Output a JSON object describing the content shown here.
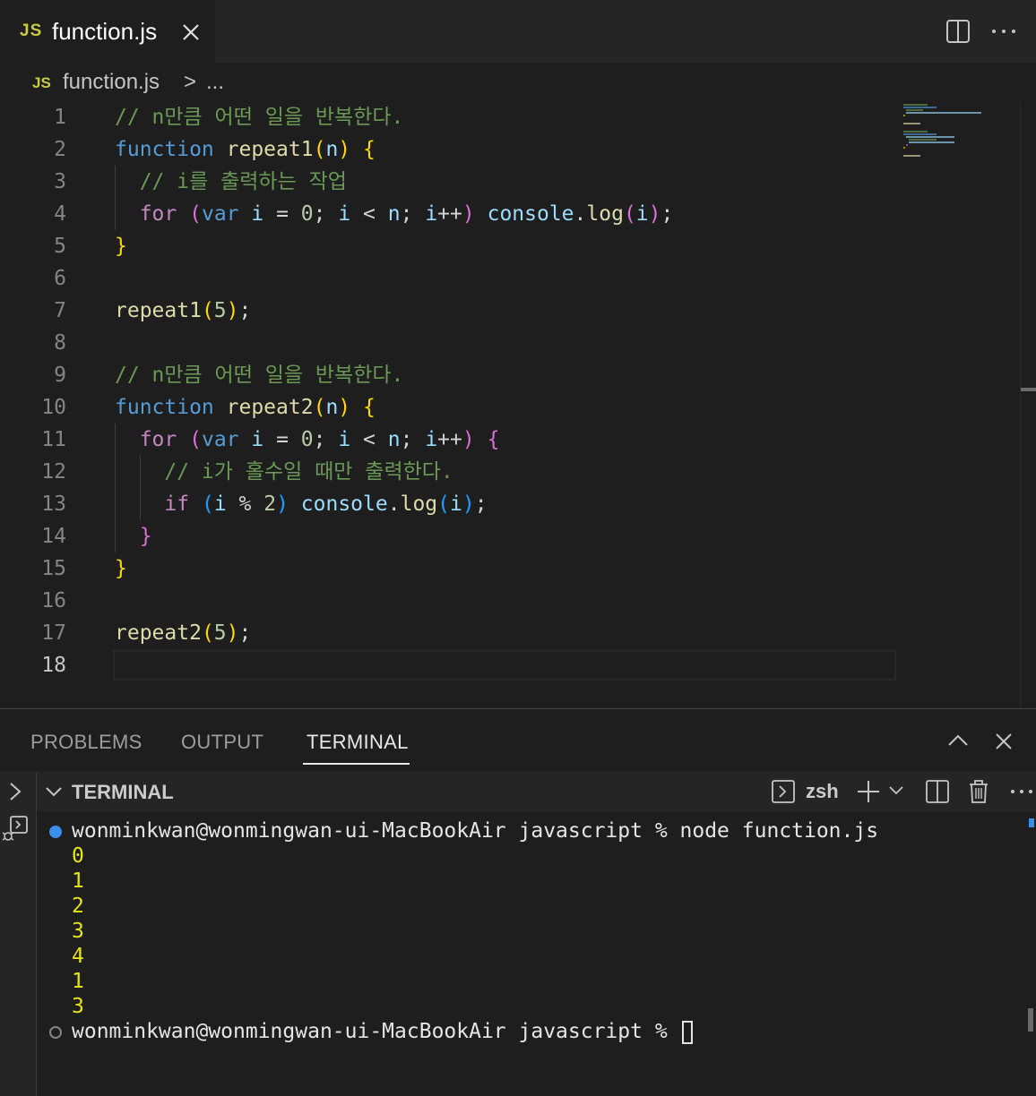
{
  "tab": {
    "icon_text": "JS",
    "filename": "function.js"
  },
  "breadcrumb": {
    "icon_text": "JS",
    "file": "function.js",
    "separator": ">",
    "more": "..."
  },
  "editor": {
    "active_line": 18,
    "lines": [
      {
        "n": "1",
        "t": [
          [
            "cm",
            "// n만큼 어떤 일을 반복한다."
          ]
        ]
      },
      {
        "n": "2",
        "t": [
          [
            "kw",
            "function"
          ],
          [
            "pn",
            " "
          ],
          [
            "fn",
            "repeat1"
          ],
          [
            "b1",
            "("
          ],
          [
            "pr",
            "n"
          ],
          [
            "b1",
            ")"
          ],
          [
            "pn",
            " "
          ],
          [
            "b1",
            "{"
          ]
        ]
      },
      {
        "n": "3",
        "t": [
          [
            "pn",
            "  "
          ],
          [
            "cm",
            "// i를 출력하는 작업"
          ]
        ]
      },
      {
        "n": "4",
        "t": [
          [
            "pn",
            "  "
          ],
          [
            "ct",
            "for"
          ],
          [
            "pn",
            " "
          ],
          [
            "b2",
            "("
          ],
          [
            "kw",
            "var"
          ],
          [
            "pn",
            " "
          ],
          [
            "pr",
            "i"
          ],
          [
            "pn",
            " = "
          ],
          [
            "nu",
            "0"
          ],
          [
            "pn",
            "; "
          ],
          [
            "pr",
            "i"
          ],
          [
            "pn",
            " < "
          ],
          [
            "pr",
            "n"
          ],
          [
            "pn",
            "; "
          ],
          [
            "pr",
            "i"
          ],
          [
            "pn",
            "++"
          ],
          [
            "b2",
            ")"
          ],
          [
            "pn",
            " "
          ],
          [
            "pr",
            "console"
          ],
          [
            "pn",
            "."
          ],
          [
            "fn",
            "log"
          ],
          [
            "b2",
            "("
          ],
          [
            "pr",
            "i"
          ],
          [
            "b2",
            ")"
          ],
          [
            "pn",
            ";"
          ]
        ]
      },
      {
        "n": "5",
        "t": [
          [
            "b1",
            "}"
          ]
        ]
      },
      {
        "n": "6",
        "t": []
      },
      {
        "n": "7",
        "t": [
          [
            "fn",
            "repeat1"
          ],
          [
            "b1",
            "("
          ],
          [
            "nu",
            "5"
          ],
          [
            "b1",
            ")"
          ],
          [
            "pn",
            ";"
          ]
        ]
      },
      {
        "n": "8",
        "t": []
      },
      {
        "n": "9",
        "t": [
          [
            "cm",
            "// n만큼 어떤 일을 반복한다."
          ]
        ]
      },
      {
        "n": "10",
        "t": [
          [
            "kw",
            "function"
          ],
          [
            "pn",
            " "
          ],
          [
            "fn",
            "repeat2"
          ],
          [
            "b1",
            "("
          ],
          [
            "pr",
            "n"
          ],
          [
            "b1",
            ")"
          ],
          [
            "pn",
            " "
          ],
          [
            "b1",
            "{"
          ]
        ]
      },
      {
        "n": "11",
        "t": [
          [
            "pn",
            "  "
          ],
          [
            "ct",
            "for"
          ],
          [
            "pn",
            " "
          ],
          [
            "b2",
            "("
          ],
          [
            "kw",
            "var"
          ],
          [
            "pn",
            " "
          ],
          [
            "pr",
            "i"
          ],
          [
            "pn",
            " = "
          ],
          [
            "nu",
            "0"
          ],
          [
            "pn",
            "; "
          ],
          [
            "pr",
            "i"
          ],
          [
            "pn",
            " < "
          ],
          [
            "pr",
            "n"
          ],
          [
            "pn",
            "; "
          ],
          [
            "pr",
            "i"
          ],
          [
            "pn",
            "++"
          ],
          [
            "b2",
            ")"
          ],
          [
            "pn",
            " "
          ],
          [
            "b2",
            "{"
          ]
        ]
      },
      {
        "n": "12",
        "t": [
          [
            "pn",
            "    "
          ],
          [
            "cm",
            "// i가 홀수일 때만 출력한다."
          ]
        ]
      },
      {
        "n": "13",
        "t": [
          [
            "pn",
            "    "
          ],
          [
            "ct",
            "if"
          ],
          [
            "pn",
            " "
          ],
          [
            "b3",
            "("
          ],
          [
            "pr",
            "i"
          ],
          [
            "pn",
            " % "
          ],
          [
            "nu",
            "2"
          ],
          [
            "b3",
            ")"
          ],
          [
            "pn",
            " "
          ],
          [
            "pr",
            "console"
          ],
          [
            "pn",
            "."
          ],
          [
            "fn",
            "log"
          ],
          [
            "b3",
            "("
          ],
          [
            "pr",
            "i"
          ],
          [
            "b3",
            ")"
          ],
          [
            "pn",
            ";"
          ]
        ]
      },
      {
        "n": "14",
        "t": [
          [
            "pn",
            "  "
          ],
          [
            "b2",
            "}"
          ]
        ]
      },
      {
        "n": "15",
        "t": [
          [
            "b1",
            "}"
          ]
        ]
      },
      {
        "n": "16",
        "t": []
      },
      {
        "n": "17",
        "t": [
          [
            "fn",
            "repeat2"
          ],
          [
            "b1",
            "("
          ],
          [
            "nu",
            "5"
          ],
          [
            "b1",
            ")"
          ],
          [
            "pn",
            ";"
          ]
        ]
      },
      {
        "n": "18",
        "t": []
      }
    ]
  },
  "panel": {
    "tabs": [
      "PROBLEMS",
      "OUTPUT",
      "TERMINAL"
    ],
    "active_tab": "TERMINAL",
    "terminal_title": "TERMINAL",
    "shell": "zsh"
  },
  "terminal": {
    "command_line": "wonminkwan@wonmingwan-ui-MacBookAir javascript % node function.js",
    "output": [
      "0",
      "1",
      "2",
      "3",
      "4",
      "1",
      "3"
    ],
    "prompt": "wonminkwan@wonmingwan-ui-MacBookAir javascript % "
  },
  "colors": {
    "background": "#1e1e1e",
    "keyword": "#569cd6",
    "function": "#dcdcaa",
    "comment": "#6a9955",
    "number": "#b5cea8",
    "output": "#e5e510"
  },
  "icons": [
    "js-file-icon",
    "close-icon",
    "split-editor-icon",
    "more-actions-icon",
    "chevron-up-icon",
    "chevron-right-icon",
    "debug-console-icon",
    "terminal-icon",
    "plus-icon",
    "chevron-down-icon",
    "trash-icon"
  ]
}
